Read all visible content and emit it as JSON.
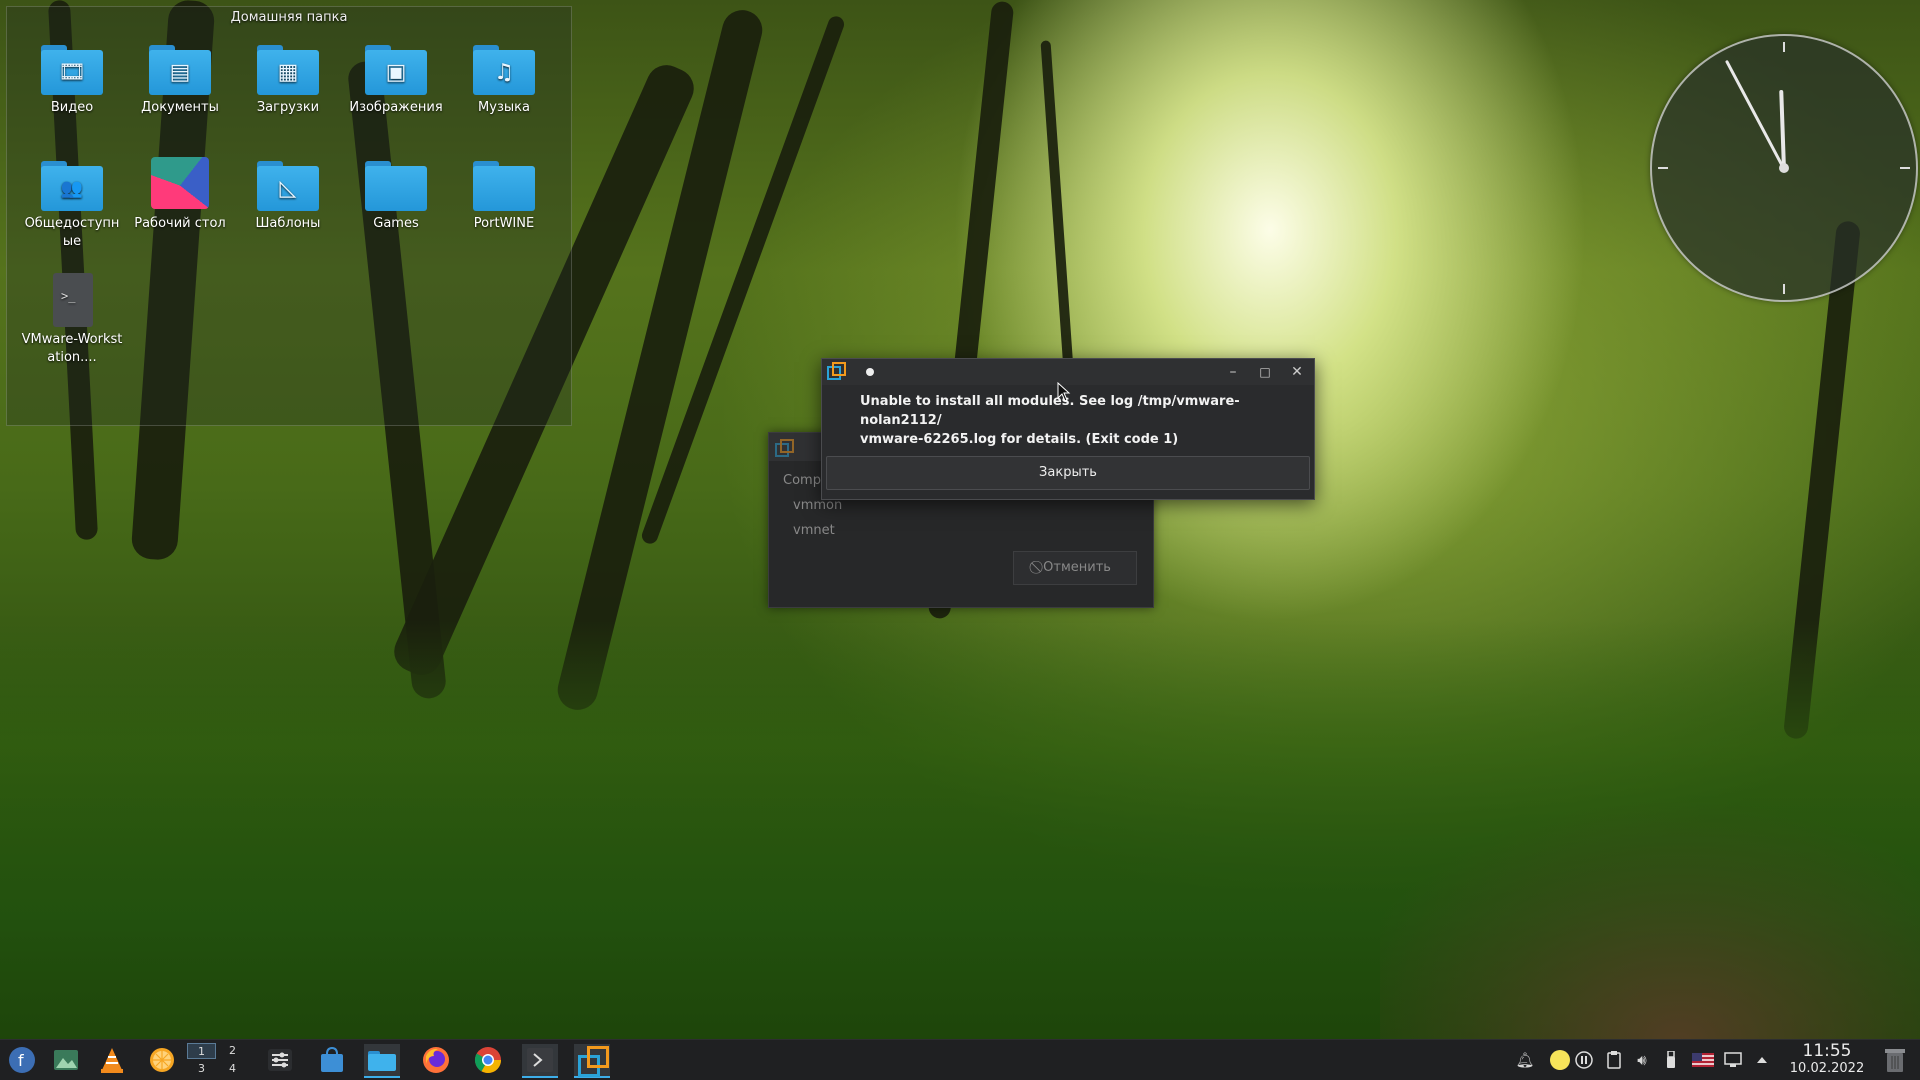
{
  "folder_view": {
    "title": "Домашняя папка",
    "items": [
      {
        "label": "Видео",
        "icon": "video-folder-icon",
        "glyph": "🎞"
      },
      {
        "label": "Документы",
        "icon": "documents-folder-icon",
        "glyph": "▤"
      },
      {
        "label": "Загрузки",
        "icon": "downloads-folder-icon",
        "glyph": "▦"
      },
      {
        "label": "Изображения",
        "icon": "pictures-folder-icon",
        "glyph": "▣"
      },
      {
        "label": "Музыка",
        "icon": "music-folder-icon",
        "glyph": "♫"
      },
      {
        "label": "Общедоступные",
        "icon": "public-folder-icon",
        "glyph": "👥"
      },
      {
        "label": "Рабочий стол",
        "icon": "desktop-folder-icon",
        "glyph": ""
      },
      {
        "label": "Шаблоны",
        "icon": "templates-folder-icon",
        "glyph": "◺"
      },
      {
        "label": "Games",
        "icon": "folder-icon",
        "glyph": ""
      },
      {
        "label": "PortWINE",
        "icon": "folder-icon",
        "glyph": ""
      },
      {
        "label": "VMware-Workstation....",
        "icon": "script-file-icon",
        "glyph": ">_"
      }
    ]
  },
  "clock": {
    "hour_angle_deg": -2,
    "minute_angle_deg": -28
  },
  "background_window": {
    "header": "Comp",
    "lines": [
      "vmmon",
      "vmnet"
    ],
    "cancel_label": "⃠ Отменить"
  },
  "dialog": {
    "message_line1": "Unable to install all modules. See log /tmp/vmware-nolan2112/",
    "message_line2": "vmware-62265.log for details. (Exit code 1)",
    "close_label": "Закрыть",
    "minimize_glyph": "–",
    "maximize_glyph": "□",
    "close_glyph": "✕"
  },
  "taskbar": {
    "pager": [
      "1",
      "2",
      "3",
      "4"
    ],
    "clock_time": "11:55",
    "clock_date": "10.02.2022"
  },
  "colors": {
    "accent": "#3daee9",
    "vmware_blue": "#2aa3d8",
    "vmware_orange": "#f39a1d"
  }
}
